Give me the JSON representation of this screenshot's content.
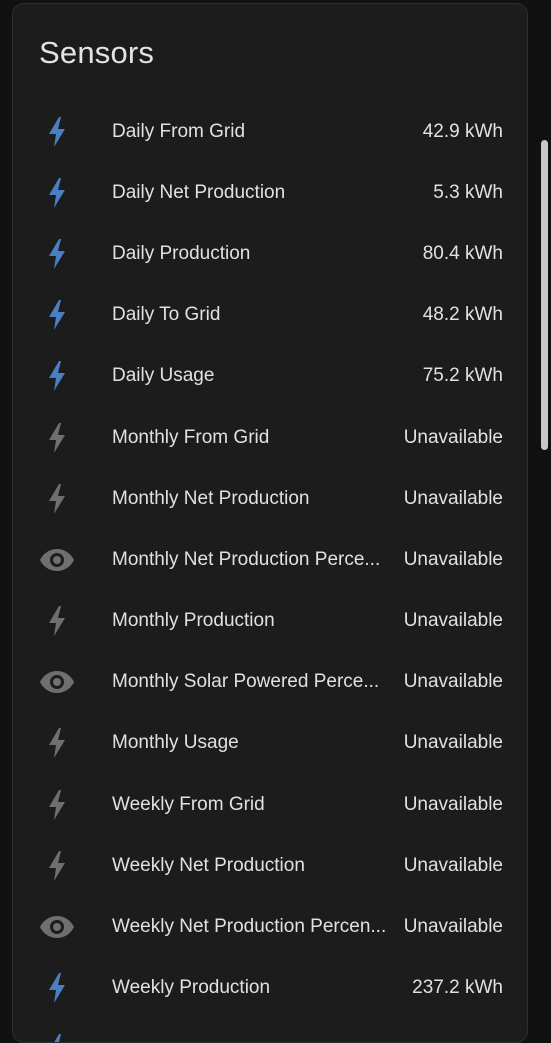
{
  "card": {
    "title": "Sensors"
  },
  "colors": {
    "accent_icon": "#4a7fc1",
    "muted_icon": "#6f6f6f"
  },
  "rows": [
    {
      "name": "Daily From Grid",
      "value": "42.9 kWh",
      "icon": "lightning-bolt-icon",
      "state": "active"
    },
    {
      "name": "Daily Net Production",
      "value": "5.3 kWh",
      "icon": "lightning-bolt-icon",
      "state": "active"
    },
    {
      "name": "Daily Production",
      "value": "80.4 kWh",
      "icon": "lightning-bolt-icon",
      "state": "active"
    },
    {
      "name": "Daily To Grid",
      "value": "48.2 kWh",
      "icon": "lightning-bolt-icon",
      "state": "active"
    },
    {
      "name": "Daily Usage",
      "value": "75.2 kWh",
      "icon": "lightning-bolt-icon",
      "state": "active"
    },
    {
      "name": "Monthly From Grid",
      "value": "Unavailable",
      "icon": "lightning-bolt-icon",
      "state": "unavailable"
    },
    {
      "name": "Monthly Net Production",
      "value": "Unavailable",
      "icon": "lightning-bolt-icon",
      "state": "unavailable"
    },
    {
      "name": "Monthly Net Production Perce...",
      "value": "Unavailable",
      "icon": "eye-icon",
      "state": "unavailable"
    },
    {
      "name": "Monthly Production",
      "value": "Unavailable",
      "icon": "lightning-bolt-icon",
      "state": "unavailable"
    },
    {
      "name": "Monthly Solar Powered Perce...",
      "value": "Unavailable",
      "icon": "eye-icon",
      "state": "unavailable"
    },
    {
      "name": "Monthly Usage",
      "value": "Unavailable",
      "icon": "lightning-bolt-icon",
      "state": "unavailable"
    },
    {
      "name": "Weekly From Grid",
      "value": "Unavailable",
      "icon": "lightning-bolt-icon",
      "state": "unavailable"
    },
    {
      "name": "Weekly Net Production",
      "value": "Unavailable",
      "icon": "lightning-bolt-icon",
      "state": "unavailable"
    },
    {
      "name": "Weekly Net Production Percen...",
      "value": "Unavailable",
      "icon": "eye-icon",
      "state": "unavailable"
    },
    {
      "name": "Weekly Production",
      "value": "237.2 kWh",
      "icon": "lightning-bolt-icon",
      "state": "active"
    },
    {
      "name": "",
      "value": "",
      "icon": "lightning-bolt-icon",
      "state": "active"
    }
  ]
}
